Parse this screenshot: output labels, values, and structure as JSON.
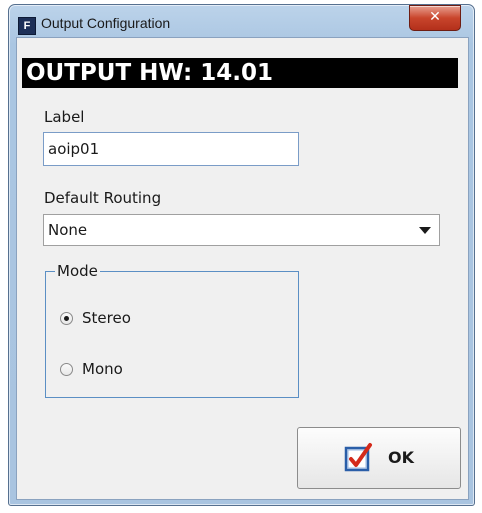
{
  "window": {
    "title": "Output Configuration",
    "app_icon_letter": "F",
    "close_glyph": "✕"
  },
  "header": {
    "text": "OUTPUT HW: 14.01"
  },
  "form": {
    "label_caption": "Label",
    "label_value": "aoip01",
    "routing_caption": "Default Routing",
    "routing_value": "None",
    "mode": {
      "title": "Mode",
      "options": [
        {
          "label": "Stereo",
          "selected": true
        },
        {
          "label": "Mono",
          "selected": false
        }
      ]
    }
  },
  "footer": {
    "ok_label": "OK"
  },
  "colors": {
    "header_bg": "#000000",
    "checkmark": "#d42a1a",
    "checkbox_border": "#2a5ea8",
    "close_button": "#c9452c"
  },
  "icons": [
    "app-icon",
    "close-icon",
    "dropdown-arrow-icon",
    "checkmark-icon"
  ]
}
